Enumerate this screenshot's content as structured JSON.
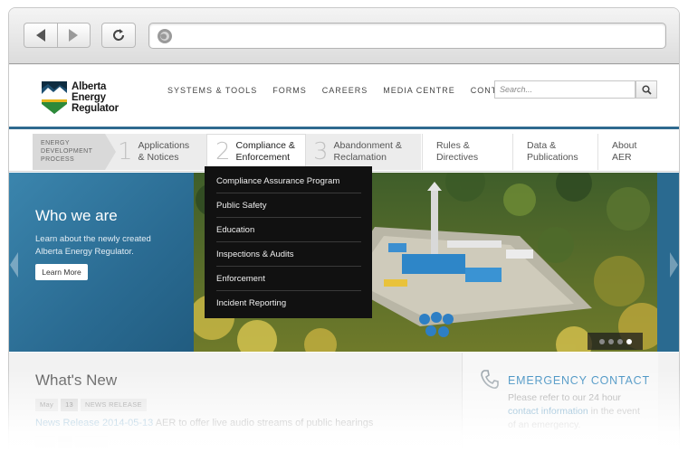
{
  "colors": {
    "brand_blue": "#2f6a8f",
    "link_blue": "#3c86b4",
    "dropdown_bg": "#111111"
  },
  "browser": {
    "back_icon": "back-arrow-icon",
    "forward_icon": "forward-arrow-icon",
    "reload_icon": "reload-icon",
    "globe_icon": "globe-icon",
    "address": ""
  },
  "header": {
    "logo_lines": [
      "Alberta",
      "Energy",
      "Regulator"
    ],
    "top_nav": [
      "SYSTEMS & TOOLS",
      "FORMS",
      "CAREERS",
      "MEDIA CENTRE",
      "CONTACT US"
    ],
    "search_placeholder": "Search...",
    "search_icon": "search-icon"
  },
  "main_nav": {
    "process_label_lines": [
      "ENERGY",
      "DEVELOPMENT",
      "PROCESS"
    ],
    "steps": [
      {
        "num": "1",
        "line1": "Applications",
        "line2": "& Notices"
      },
      {
        "num": "2",
        "line1": "Compliance &",
        "line2": "Enforcement"
      },
      {
        "num": "3",
        "line1": "Abandonment &",
        "line2": "Reclamation"
      }
    ],
    "links": [
      {
        "line1": "Rules &",
        "line2": "Directives"
      },
      {
        "line1": "Data &",
        "line2": "Publications"
      },
      {
        "line1": "About",
        "line2": "AER"
      }
    ]
  },
  "dropdown": {
    "items": [
      "Compliance Assurance Program",
      "Public Safety",
      "Education",
      "Inspections & Audits",
      "Enforcement",
      "Incident Reporting"
    ]
  },
  "hero": {
    "title": "Who we are",
    "text": "Learn about the newly created Alberta Energy Regulator.",
    "button": "Learn More",
    "slide_count": 4,
    "active_slide": 4
  },
  "news": {
    "heading": "What's New",
    "month": "May",
    "day": "13",
    "type": "NEWS RELEASE",
    "link": "News Release 2014-05-13",
    "text": " AER to offer live audio streams of public hearings"
  },
  "emergency": {
    "icon": "phone-icon",
    "title": "EMERGENCY CONTACT",
    "text_before": "Please refer to our 24 hour ",
    "link": "contact information",
    "text_after": " in the event of an emergency."
  }
}
